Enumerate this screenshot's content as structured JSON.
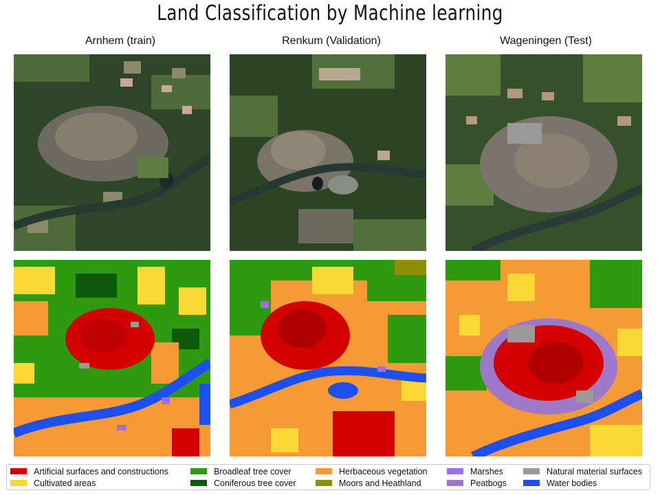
{
  "title": "Land Classification by Machine learning",
  "columns": [
    {
      "label": "Arnhem (train)"
    },
    {
      "label": "Renkum (Validation)"
    },
    {
      "label": "Wageningen (Test)"
    }
  ],
  "legend": [
    {
      "label": "Artificial surfaces and constructions",
      "color": "#d40000"
    },
    {
      "label": "Cultivated areas",
      "color": "#f8d833"
    },
    {
      "label": "Broadleaf tree cover",
      "color": "#2f9a10"
    },
    {
      "label": "Coniferous tree cover",
      "color": "#0f5a0a"
    },
    {
      "label": "Herbaceous vegetation",
      "color": "#f59a35"
    },
    {
      "label": "Moors and Heathland",
      "color": "#8f8f07"
    },
    {
      "label": "Marshes",
      "color": "#a06cf2"
    },
    {
      "label": "Peatbogs",
      "color": "#9e79c9"
    },
    {
      "label": "Natural material surfaces",
      "color": "#9a9a9a"
    },
    {
      "label": "Water bodies",
      "color": "#1c4ef0"
    }
  ]
}
